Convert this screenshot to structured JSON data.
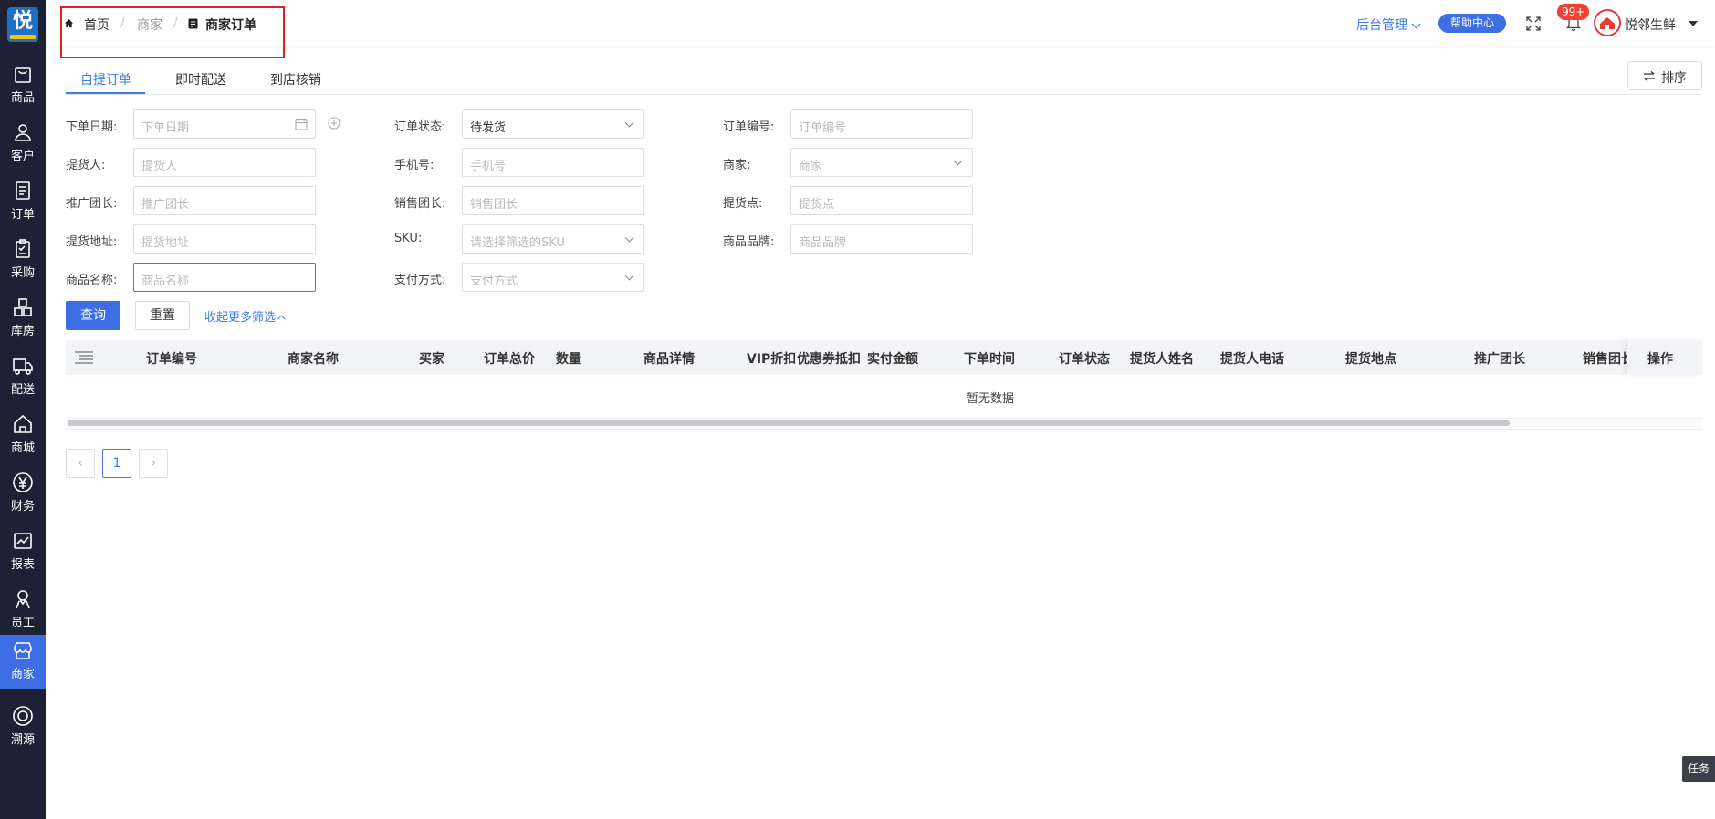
{
  "app": {
    "logo_text": "悦"
  },
  "sidebar": {
    "items": [
      {
        "label": "商品",
        "icon": "bag-icon"
      },
      {
        "label": "客户",
        "icon": "user-icon"
      },
      {
        "label": "订单",
        "icon": "order-icon"
      },
      {
        "label": "采购",
        "icon": "clipboard-icon"
      },
      {
        "label": "库房",
        "icon": "warehouse-icon"
      },
      {
        "label": "配送",
        "icon": "truck-icon"
      },
      {
        "label": "商城",
        "icon": "home-icon"
      },
      {
        "label": "财务",
        "icon": "yen-icon"
      },
      {
        "label": "报表",
        "icon": "chart-icon"
      },
      {
        "label": "员工",
        "icon": "staff-icon"
      },
      {
        "label": "商家",
        "icon": "shop-icon",
        "active": true
      },
      {
        "label": "溯源",
        "icon": "target-icon"
      }
    ]
  },
  "breadcrumb": {
    "home": "首页",
    "sep": "/",
    "parent": "商家",
    "current": "商家订单"
  },
  "header": {
    "admin_menu": "后台管理",
    "help_center": "帮助中心",
    "badge": "99+",
    "user_name": "悦邻生鲜"
  },
  "tabs": [
    "自提订单",
    "即时配送",
    "到店核销"
  ],
  "sort_button": "排序",
  "filters": {
    "order_date": {
      "label": "下单日期:",
      "placeholder": "下单日期"
    },
    "order_status": {
      "label": "订单状态:",
      "value": "待发货"
    },
    "order_no": {
      "label": "订单编号:",
      "placeholder": "订单编号"
    },
    "picker": {
      "label": "提货人:",
      "placeholder": "提货人"
    },
    "phone": {
      "label": "手机号:",
      "placeholder": "手机号"
    },
    "merchant": {
      "label": "商家:",
      "placeholder": "商家"
    },
    "promo_leader": {
      "label": "推广团长:",
      "placeholder": "推广团长"
    },
    "sales_leader": {
      "label": "销售团长:",
      "placeholder": "销售团长"
    },
    "pickup_point": {
      "label": "提货点:",
      "placeholder": "提货点"
    },
    "pickup_address": {
      "label": "提货地址:",
      "placeholder": "提货地址"
    },
    "sku": {
      "label": "SKU:",
      "placeholder": "请选择筛选的SKU"
    },
    "brand": {
      "label": "商品品牌:",
      "placeholder": "商品品牌"
    },
    "product_name": {
      "label": "商品名称:",
      "placeholder": "商品名称"
    },
    "payment": {
      "label": "支付方式:",
      "placeholder": "支付方式"
    }
  },
  "actions": {
    "query": "查询",
    "reset": "重置",
    "collapse": "收起更多筛选"
  },
  "table": {
    "columns": [
      "订单编号",
      "商家名称",
      "买家",
      "订单总价",
      "数量",
      "商品详情",
      "VIP折扣",
      "优惠券抵扣",
      "实付金额",
      "下单时间",
      "订单状态",
      "提货人姓名",
      "提货人电话",
      "提货地点",
      "推广团长",
      "销售团长",
      "操作"
    ],
    "empty_text": "暂无数据"
  },
  "pagination": {
    "current": "1",
    "prev": "‹",
    "next": "›"
  },
  "task_button": "任务",
  "colors": {
    "primary": "#3d6ee6",
    "sidebar": "#1c2233",
    "badge": "#f04134"
  }
}
